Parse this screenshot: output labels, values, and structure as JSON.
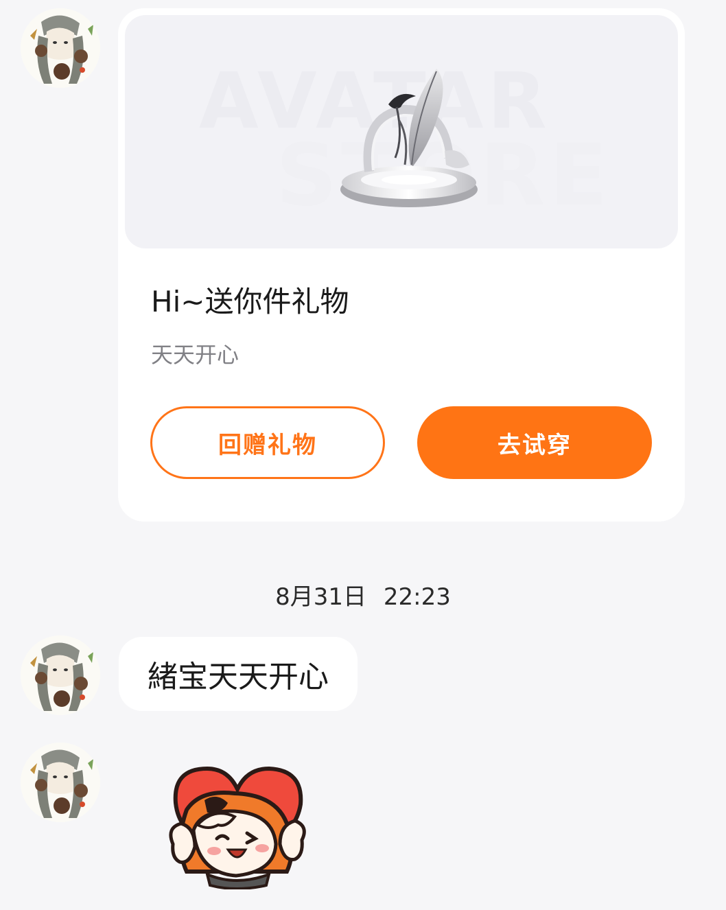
{
  "gift_card": {
    "banner_words": [
      "AVATAR",
      "STORE"
    ],
    "title": "Hi~送你件礼物",
    "subtitle": "天天开心",
    "return_gift_label": "回赠礼物",
    "try_on_label": "去试穿"
  },
  "timestamp": "8月31日 22:23",
  "messages": [
    {
      "text": "緒宝天天开心"
    }
  ],
  "colors": {
    "accent": "#ff7414",
    "background": "#f6f6f8",
    "card": "#ffffff"
  },
  "icons": {
    "avatar": "user-avatar-icon",
    "sticker": "hug-heart-sticker"
  }
}
